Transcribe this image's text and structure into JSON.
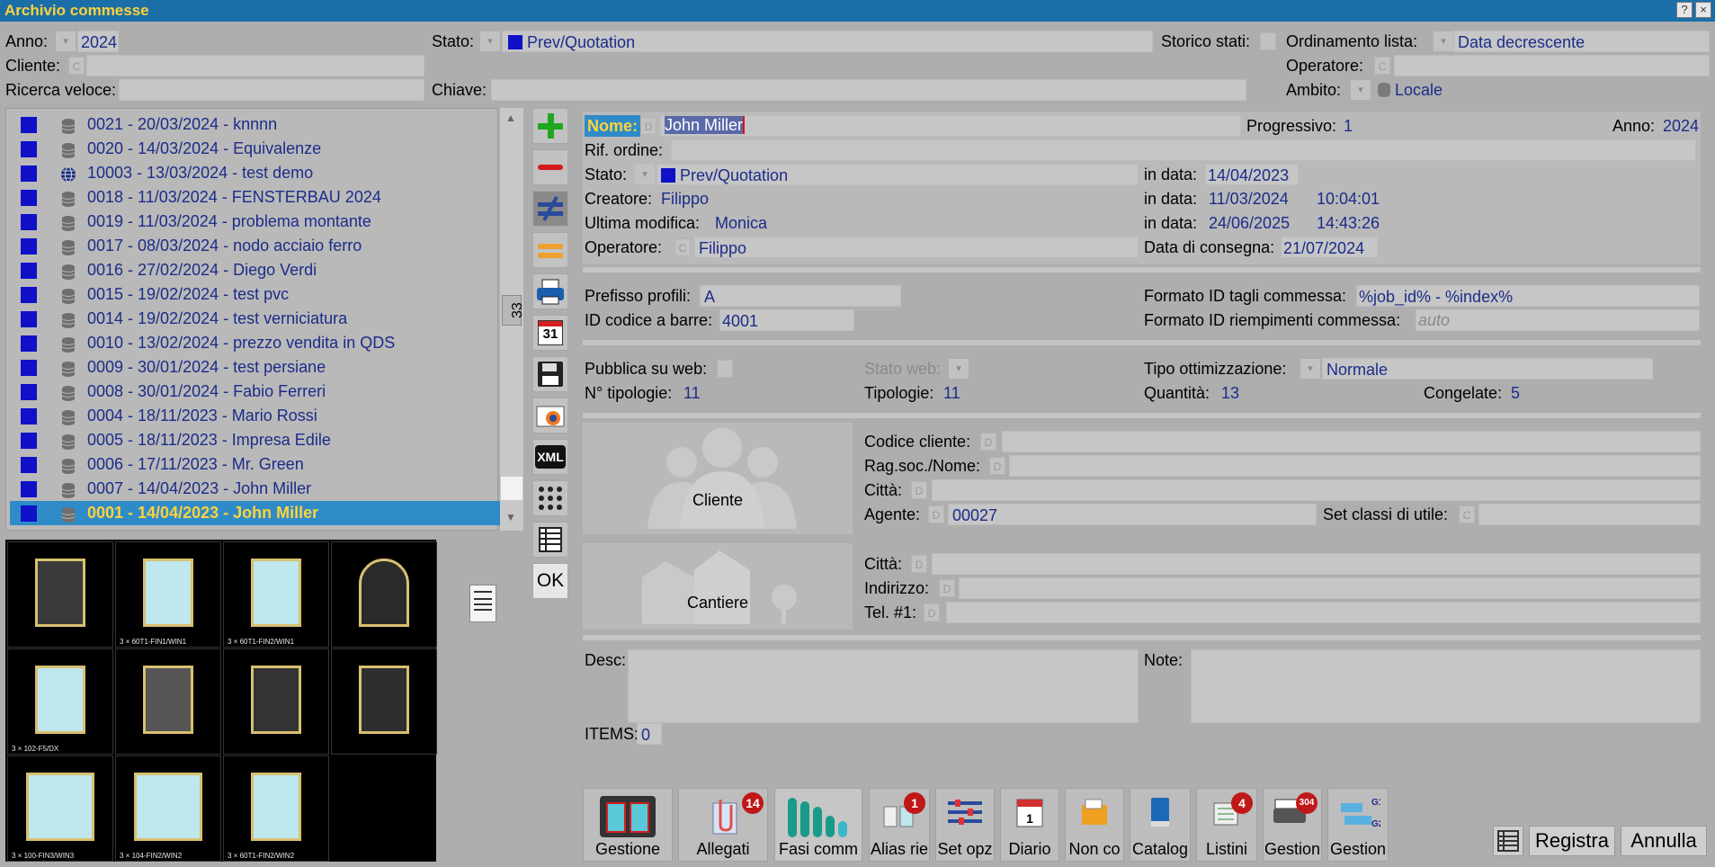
{
  "window": {
    "title": "Archivio commesse",
    "help": "?",
    "close": "×"
  },
  "filters": {
    "anno_label": "Anno:",
    "anno_value": "2024",
    "stato_label": "Stato:",
    "stato_value": "Prev/Quotation",
    "storico_label": "Storico stati:",
    "ordinamento_label": "Ordinamento lista:",
    "ordinamento_value": "Data decrescente",
    "cliente_label": "Cliente:",
    "cliente_btn": "C",
    "operatore_label": "Operatore:",
    "operatore_btn": "C",
    "ricerca_label": "Ricerca veloce:",
    "chiave_label": "Chiave:",
    "ambito_label": "Ambito:",
    "ambito_value": "Locale"
  },
  "list": {
    "items": [
      {
        "label": "0021 - 20/03/2024 - knnnn",
        "icon": "database-icon"
      },
      {
        "label": "0020 - 14/03/2024 - Equivalenze",
        "icon": "database-icon"
      },
      {
        "label": "10003 - 13/03/2024 - test demo",
        "icon": "globe-icon"
      },
      {
        "label": "0018 - 11/03/2024 - FENSTERBAU 2024",
        "icon": "database-icon"
      },
      {
        "label": "0019 - 11/03/2024 - problema montante",
        "icon": "database-icon"
      },
      {
        "label": "0017 - 08/03/2024 - nodo acciaio ferro",
        "icon": "database-icon"
      },
      {
        "label": "0016 - 27/02/2024 - Diego Verdi",
        "icon": "database-icon"
      },
      {
        "label": "0015 - 19/02/2024 - test pvc",
        "icon": "database-icon"
      },
      {
        "label": "0014 - 19/02/2024 - test verniciatura",
        "icon": "database-icon"
      },
      {
        "label": "0010 - 13/02/2024 - prezzo vendita in QDS",
        "icon": "database-icon"
      },
      {
        "label": "0009 - 30/01/2024 - test persiane",
        "icon": "database-icon"
      },
      {
        "label": "0008 - 30/01/2024 - Fabio Ferreri",
        "icon": "database-icon"
      },
      {
        "label": "0004 - 18/11/2023 - Mario Rossi",
        "icon": "database-icon"
      },
      {
        "label": "0005 - 18/11/2023 - Impresa Edile",
        "icon": "database-icon"
      },
      {
        "label": "0006 - 17/11/2023 - Mr. Green",
        "icon": "database-icon"
      },
      {
        "label": "0007 - 14/04/2023 - John Miller",
        "icon": "database-icon"
      },
      {
        "label": "0001 - 14/04/2023 - John Miller",
        "icon": "database-icon",
        "selected": true
      }
    ],
    "count": "33"
  },
  "tools": {
    "ok": "OK",
    "xml": "XML",
    "calendar": "31"
  },
  "thumbnails": [
    {
      "caption": "",
      "color": "#3a3a3a"
    },
    {
      "caption": "3 × 60T1-FIN1/WIN1",
      "color": "#bfe7ee"
    },
    {
      "caption": "3 × 60T1-FIN2/WIN1",
      "color": "#bfe7ee"
    },
    {
      "caption": "",
      "color": "#2a2a2a"
    },
    {
      "caption": "3 × 102-F5/DX",
      "color": "#bfe7ee"
    },
    {
      "caption": "",
      "color": "#555555"
    },
    {
      "caption": "",
      "color": "#333333"
    },
    {
      "caption": "",
      "color": "#2e2e2e"
    },
    {
      "caption": "3 × 100-FIN3/WIN3",
      "color": "#bfe7ee"
    },
    {
      "caption": "3 × 104-FIN2/WIN2",
      "color": "#bfe7ee"
    },
    {
      "caption": "3 × 60T1-FIN2/WIN2",
      "color": "#bfe7ee"
    }
  ],
  "detail": {
    "nome_label": "Nome:",
    "nome_btn": "D",
    "nome_value": "John Miller",
    "progressivo_label": "Progressivo:",
    "progressivo_value": "1",
    "anno_label": "Anno:",
    "anno_value": "2024",
    "rif_label": "Rif. ordine:",
    "stato_label": "Stato:",
    "stato_value": "Prev/Quotation",
    "stato_data_label": "in data:",
    "stato_data_value": "14/04/2023",
    "creatore_label": "Creatore:",
    "creatore_value": "Filippo",
    "creatore_data_label": "in data:",
    "creatore_data_value": "11/03/2024",
    "creatore_ora": "10:04:01",
    "modifica_label": "Ultima modifica:",
    "modifica_value": "Monica",
    "modifica_data_label": "in data:",
    "modifica_data_value": "24/06/2025",
    "modifica_ora": "14:43:26",
    "operatore_label": "Operatore:",
    "operatore_btn": "C",
    "operatore_value": "Filippo",
    "consegna_label": "Data di consegna:",
    "consegna_value": "21/07/2024",
    "prefisso_label": "Prefisso profili:",
    "prefisso_value": "A",
    "formato_tagli_label": "Formato ID tagli commessa:",
    "formato_tagli_value": "%job_id% - %index%",
    "barre_label": "ID codice a barre:",
    "barre_value": "4001",
    "formato_riemp_label": "Formato ID riempimenti commessa:",
    "formato_riemp_value": "auto",
    "pubblica_label": "Pubblica su web:",
    "statoweb_label": "Stato web:",
    "tipo_ott_label": "Tipo ottimizzazione:",
    "tipo_ott_value": "Normale",
    "ntip_label": "N° tipologie:",
    "ntip_value": "11",
    "tip_label": "Tipologie:",
    "tip_value": "11",
    "quantita_label": "Quantità:",
    "quantita_value": "13",
    "congelate_label": "Congelate:",
    "congelate_value": "5",
    "cliente_title": "Cliente",
    "codcli_label": "Codice cliente:",
    "ragsoc_label": "Rag.soc./Nome:",
    "citta_label": "Città:",
    "agente_label": "Agente:",
    "agente_value": "00027",
    "setclassi_label": "Set classi di utile:",
    "setclassi_btn": "C",
    "cantiere_title": "Cantiere",
    "cant_citta_label": "Città:",
    "cant_indirizzo_label": "Indirizzo:",
    "cant_tel_label": "Tel. #1:",
    "desc_label": "Desc:",
    "note_label": "Note:",
    "items_label": "ITEMS:",
    "items_value": "0",
    "btn_d": "D"
  },
  "bottom": {
    "buttons": [
      {
        "label": "Gestione"
      },
      {
        "label": "Allegati",
        "badge": "14"
      },
      {
        "label": "Fasi comm"
      },
      {
        "label": "Alias rie",
        "badge": "1"
      },
      {
        "label": "Set opz"
      },
      {
        "label": "Diario"
      },
      {
        "label": "Non co"
      },
      {
        "label": "Catalog"
      },
      {
        "label": "Listini",
        "badge": "4"
      },
      {
        "label": "Gestion",
        "badge": "304"
      },
      {
        "label": "Gestion"
      }
    ],
    "registra": "Registra",
    "annulla": "Annulla"
  }
}
